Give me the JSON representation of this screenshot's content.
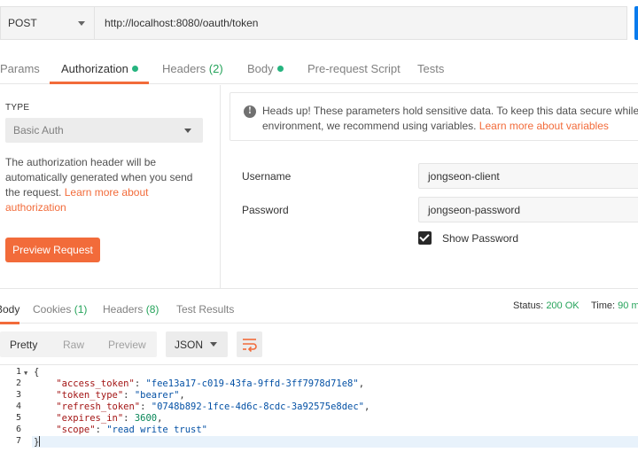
{
  "request": {
    "method": "POST",
    "url": "http://localhost:8080/oauth/token"
  },
  "request_tabs": [
    {
      "label": "Params"
    },
    {
      "label": "Authorization",
      "indicator": true
    },
    {
      "label": "Headers",
      "count": "(2)"
    },
    {
      "label": "Body",
      "indicator": true
    },
    {
      "label": "Pre-request Script"
    },
    {
      "label": "Tests"
    }
  ],
  "auth": {
    "type_label": "TYPE",
    "type_value": "Basic Auth",
    "description": "The authorization header will be automatically generated when you send the request.",
    "learn_more_link": "Learn more about authorization",
    "preview_button": "Preview Request",
    "heads_up_line1": "Heads up! These parameters hold sensitive data. To keep this data secure while",
    "heads_up_line2_prefix": "environment, we recommend using variables.",
    "heads_up_link": "Learn more about variables",
    "username_label": "Username",
    "username_value": "jongseon-client",
    "password_label": "Password",
    "password_value": "jongseon-password",
    "show_password_label": "Show Password",
    "show_password_checked": true
  },
  "response_tabs": [
    {
      "label": "Body"
    },
    {
      "label": "Cookies",
      "count": "(1)"
    },
    {
      "label": "Headers",
      "count": "(8)"
    },
    {
      "label": "Test Results"
    }
  ],
  "response_status": {
    "status_label": "Status:",
    "status_value": "200 OK",
    "time_label": "Time:",
    "time_value": "90 m"
  },
  "response_toolbar": {
    "view_modes": [
      "Pretty",
      "Raw",
      "Preview"
    ],
    "format": "JSON",
    "wrap_icon": "wrap-lines-icon"
  },
  "response_body": {
    "open_brace": "{",
    "close_brace": "}",
    "fields": [
      {
        "key": "\"access_token\"",
        "value": "\"fee13a17-c019-43fa-9ffd-3ff7978d71e8\"",
        "comma": ","
      },
      {
        "key": "\"token_type\"",
        "value": "\"bearer\"",
        "comma": ","
      },
      {
        "key": "\"refresh_token\"",
        "value": "\"0748b892-1fce-4d6c-8cdc-3a92575e8dec\"",
        "comma": ","
      },
      {
        "key": "\"expires_in\"",
        "value": "3600",
        "comma": ","
      },
      {
        "key": "\"scope\"",
        "value": "\"read write trust\"",
        "comma": ""
      }
    ],
    "line_numbers": [
      "1",
      "2",
      "3",
      "4",
      "5",
      "6",
      "7"
    ]
  },
  "colors": {
    "accent": "#f26b3a",
    "success": "#25a35a",
    "send_button": "#097bed"
  }
}
